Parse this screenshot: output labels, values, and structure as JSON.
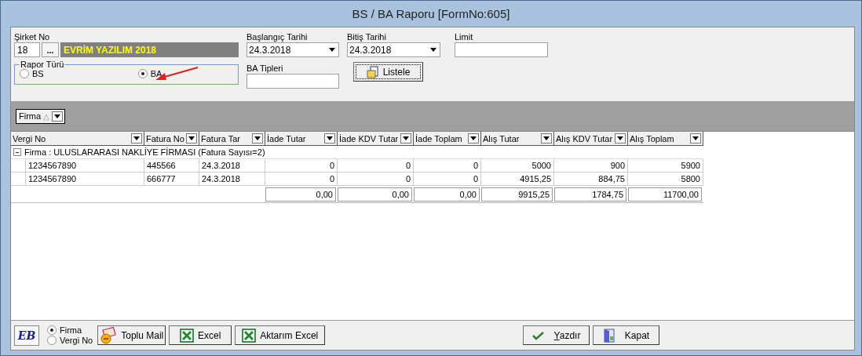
{
  "window": {
    "title": "BS / BA Raporu [FormNo:605]"
  },
  "filters": {
    "company": {
      "label": "Şirket No",
      "code": "18",
      "browse": "...",
      "name": "EVRİM YAZILIM 2018"
    },
    "start_date": {
      "label": "Başlangıç Tarihi",
      "value": "24.3.2018"
    },
    "end_date": {
      "label": "Bitiş Tarihi",
      "value": "24.3.2018"
    },
    "limit": {
      "label": "Limit"
    },
    "report_type": {
      "label": "Rapor Türü",
      "options": [
        {
          "label": "BS",
          "selected": false
        },
        {
          "label": "BA",
          "selected": true
        }
      ]
    },
    "ba_types": {
      "label": "BA Tipleri"
    },
    "list_button": "Listele"
  },
  "group_panel": {
    "chip": "Firma",
    "sort": "△"
  },
  "table": {
    "columns": [
      "Vergi No",
      "Fatura No",
      "Fatura Tar",
      "İade Tutar",
      "İade KDV Tutar",
      "İade Toplam",
      "Alış Tutar",
      "Alış KDV Tutar",
      "Alış Toplam"
    ],
    "groups": [
      {
        "label": "Firma : ULUSLARARASI NAKLİYE FİRMASI (Fatura Sayısı=2)",
        "expanded": true,
        "rows": [
          [
            "1234567890",
            "445566",
            "24.3.2018",
            "0",
            "0",
            "0",
            "5000",
            "900",
            "5900"
          ],
          [
            "1234567890",
            "666777",
            "24.3.2018",
            "0",
            "0",
            "0",
            "4915,25",
            "884,75",
            "5800"
          ]
        ]
      }
    ],
    "totals": [
      "0,00",
      "0,00",
      "0,00",
      "9915,25",
      "1784,75",
      "11700,00"
    ]
  },
  "footer": {
    "logo": "EB",
    "grouping": [
      {
        "label": "Firma",
        "selected": true
      },
      {
        "label": "Vergi No",
        "selected": false
      }
    ],
    "left_buttons": [
      {
        "kind": "mail",
        "label": "Toplu Mail"
      },
      {
        "kind": "excel",
        "label": "Excel"
      },
      {
        "kind": "excel",
        "label": "Aktarım Excel"
      }
    ],
    "right_buttons": [
      {
        "kind": "print",
        "label": "Yazdır",
        "underline_first": true
      },
      {
        "kind": "close",
        "label": "Kapat",
        "underline_first": false
      }
    ]
  }
}
